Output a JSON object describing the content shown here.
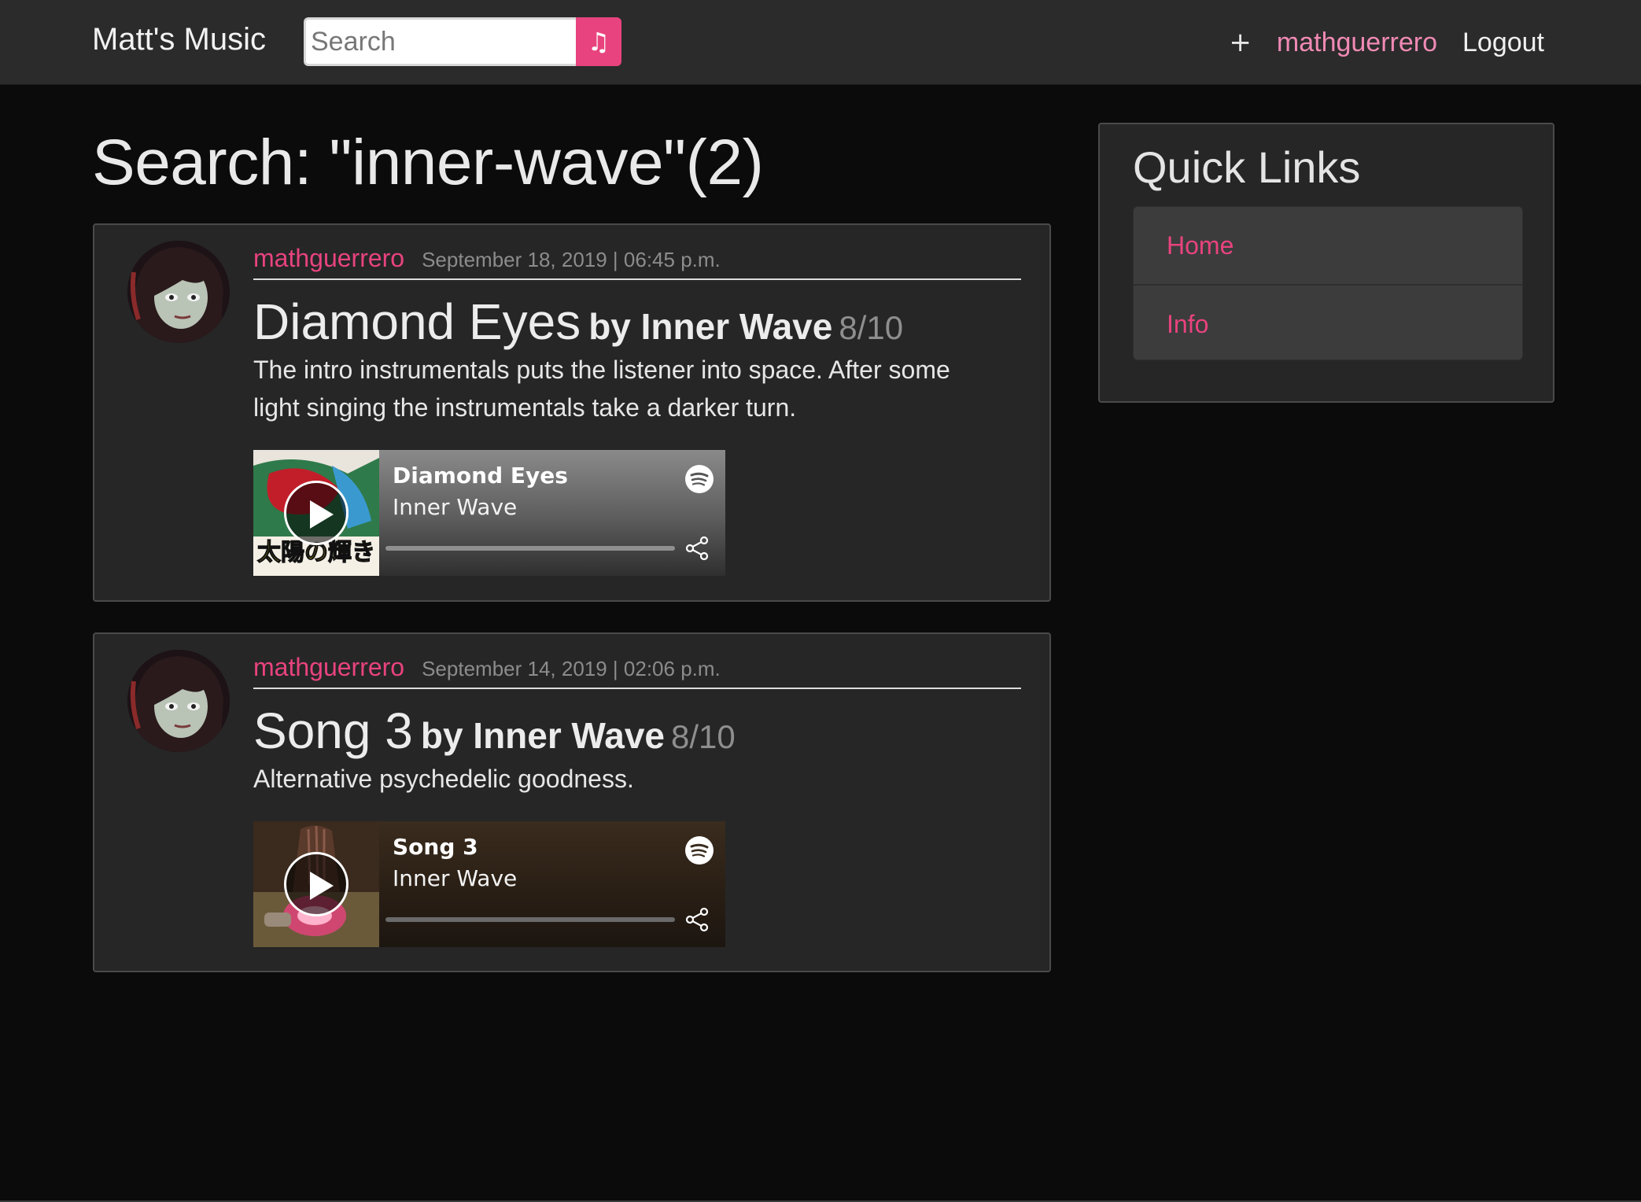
{
  "app": {
    "brand": "Matt's Music"
  },
  "search": {
    "placeholder": "Search",
    "button_icon": "music-note-icon"
  },
  "nav": {
    "add_label": "+",
    "username": "mathguerrero",
    "logout_label": "Logout"
  },
  "page": {
    "title": "Search: \"inner-wave\"(2)"
  },
  "posts": [
    {
      "author": "mathguerrero",
      "date": "September 18, 2019 | 06:45 p.m.",
      "song": "Diamond Eyes",
      "by": "by Inner Wave",
      "rating": "8/10",
      "body": "The intro instrumentals puts the listener into space. After some light singing the instrumentals take a darker turn.",
      "player": {
        "track": "Diamond Eyes",
        "artist": "Inner Wave"
      }
    },
    {
      "author": "mathguerrero",
      "date": "September 14, 2019 | 02:06 p.m.",
      "song": "Song 3",
      "by": "by Inner Wave",
      "rating": "8/10",
      "body": "Alternative psychedelic goodness.",
      "player": {
        "track": "Song 3",
        "artist": "Inner Wave"
      }
    }
  ],
  "sidebar": {
    "title": "Quick Links",
    "links": [
      {
        "label": "Home"
      },
      {
        "label": "Info"
      }
    ]
  },
  "colors": {
    "accent": "#e8437e",
    "nav_bg": "#2b2b2b",
    "page_bg": "#0b0b0b",
    "card_bg": "#262626"
  },
  "cover_art": {
    "text": "太陽の輝き"
  }
}
